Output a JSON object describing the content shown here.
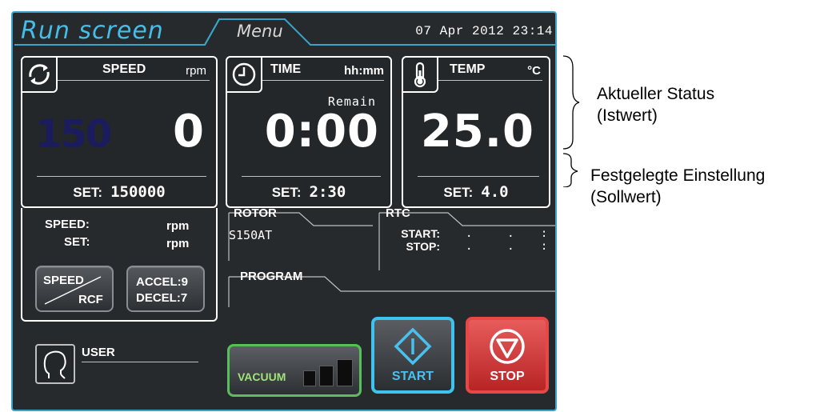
{
  "header": {
    "active_tab": "Run screen",
    "menu_tab": "Menu",
    "datetime": "07 Apr 2012 23:14"
  },
  "speed_panel": {
    "title": "SPEED",
    "unit": "rpm",
    "ghost_value": "150",
    "value": "0",
    "set_label": "SET:",
    "set_value": "150000",
    "icon": "rotate-arrows-icon"
  },
  "time_panel": {
    "title": "TIME",
    "unit": "hh:mm",
    "sub_label": "Remain",
    "value": "0:00",
    "set_label": "SET:",
    "set_value": "2:30",
    "icon": "clock-icon"
  },
  "temp_panel": {
    "title": "TEMP",
    "unit": "°C",
    "value": "25.0",
    "set_label": "SET:",
    "set_value": "4.0",
    "icon": "thermometer-icon"
  },
  "secondary": {
    "speed_label": "SPEED:",
    "speed_unit": "rpm",
    "set_label": "SET:",
    "set_unit": "rpm"
  },
  "buttons": {
    "speed_rcf_top": "SPEED",
    "speed_rcf_bottom": "RCF",
    "accel": "ACCEL:9",
    "decel": "DECEL:7",
    "vacuum": "VACUUM",
    "vacuum_level_bars": 3,
    "start": "START",
    "stop": "STOP"
  },
  "rotor": {
    "title": "ROTOR",
    "value": "S150AT"
  },
  "rtc": {
    "title": "RTC",
    "start_label": "START:",
    "stop_label": "STOP:",
    "start_value": ".    .   :",
    "stop_value": ".    .   :"
  },
  "program": {
    "title": "PROGRAM"
  },
  "user": {
    "label": "USER"
  },
  "annotations": {
    "current_line1": "Aktueller Status",
    "current_line2": "(Istwert)",
    "set_line1": "Festgelegte Einstellung",
    "set_line2": "(Sollwert)"
  },
  "colors": {
    "accent_cyan": "#3ec2ee",
    "vacuum_green": "#58c05a",
    "stop_red": "#e64848",
    "background": "#262a2d"
  }
}
